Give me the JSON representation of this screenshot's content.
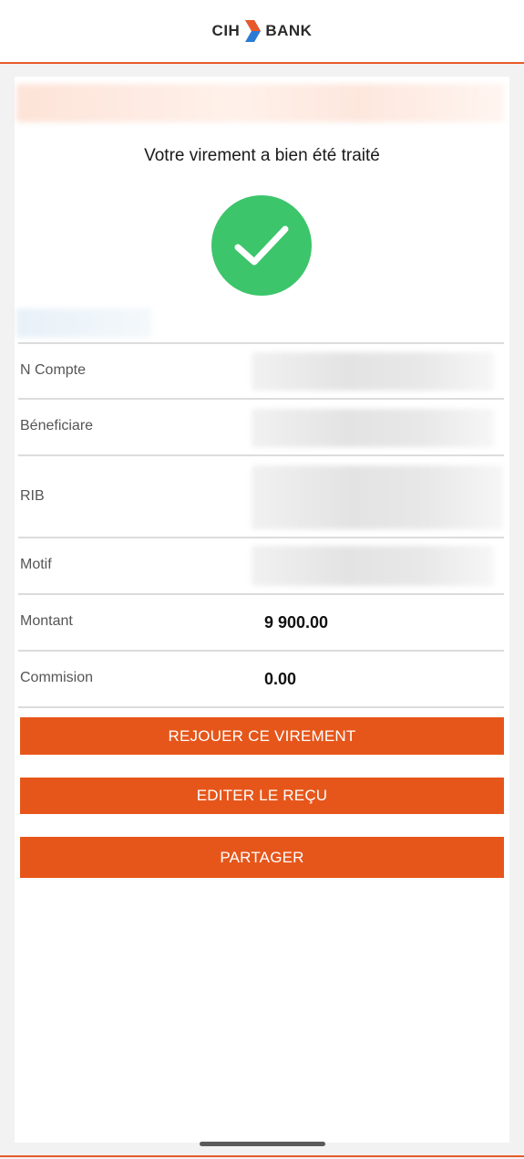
{
  "header": {
    "logo_left": "CIH",
    "logo_right": "BANK",
    "logo_icon": "chevron-arrow-icon",
    "accent_color": "#e6561a"
  },
  "confirmation": {
    "title": "Votre virement a bien été traité",
    "status_icon": "check-circle-icon",
    "status_color": "#3cc56b"
  },
  "details": {
    "rows": [
      {
        "label": "N Compte",
        "value": null
      },
      {
        "label": "Béneficiare",
        "value": null
      },
      {
        "label": "RIB",
        "value": null
      },
      {
        "label": "Motif",
        "value": null
      },
      {
        "label": "Montant",
        "value": "9 900.00"
      },
      {
        "label": "Commision",
        "value": "0.00"
      }
    ]
  },
  "actions": {
    "replay_label": "REJOUER CE VIREMENT",
    "receipt_label": "EDITER LE REÇU",
    "share_label": "PARTAGER"
  }
}
